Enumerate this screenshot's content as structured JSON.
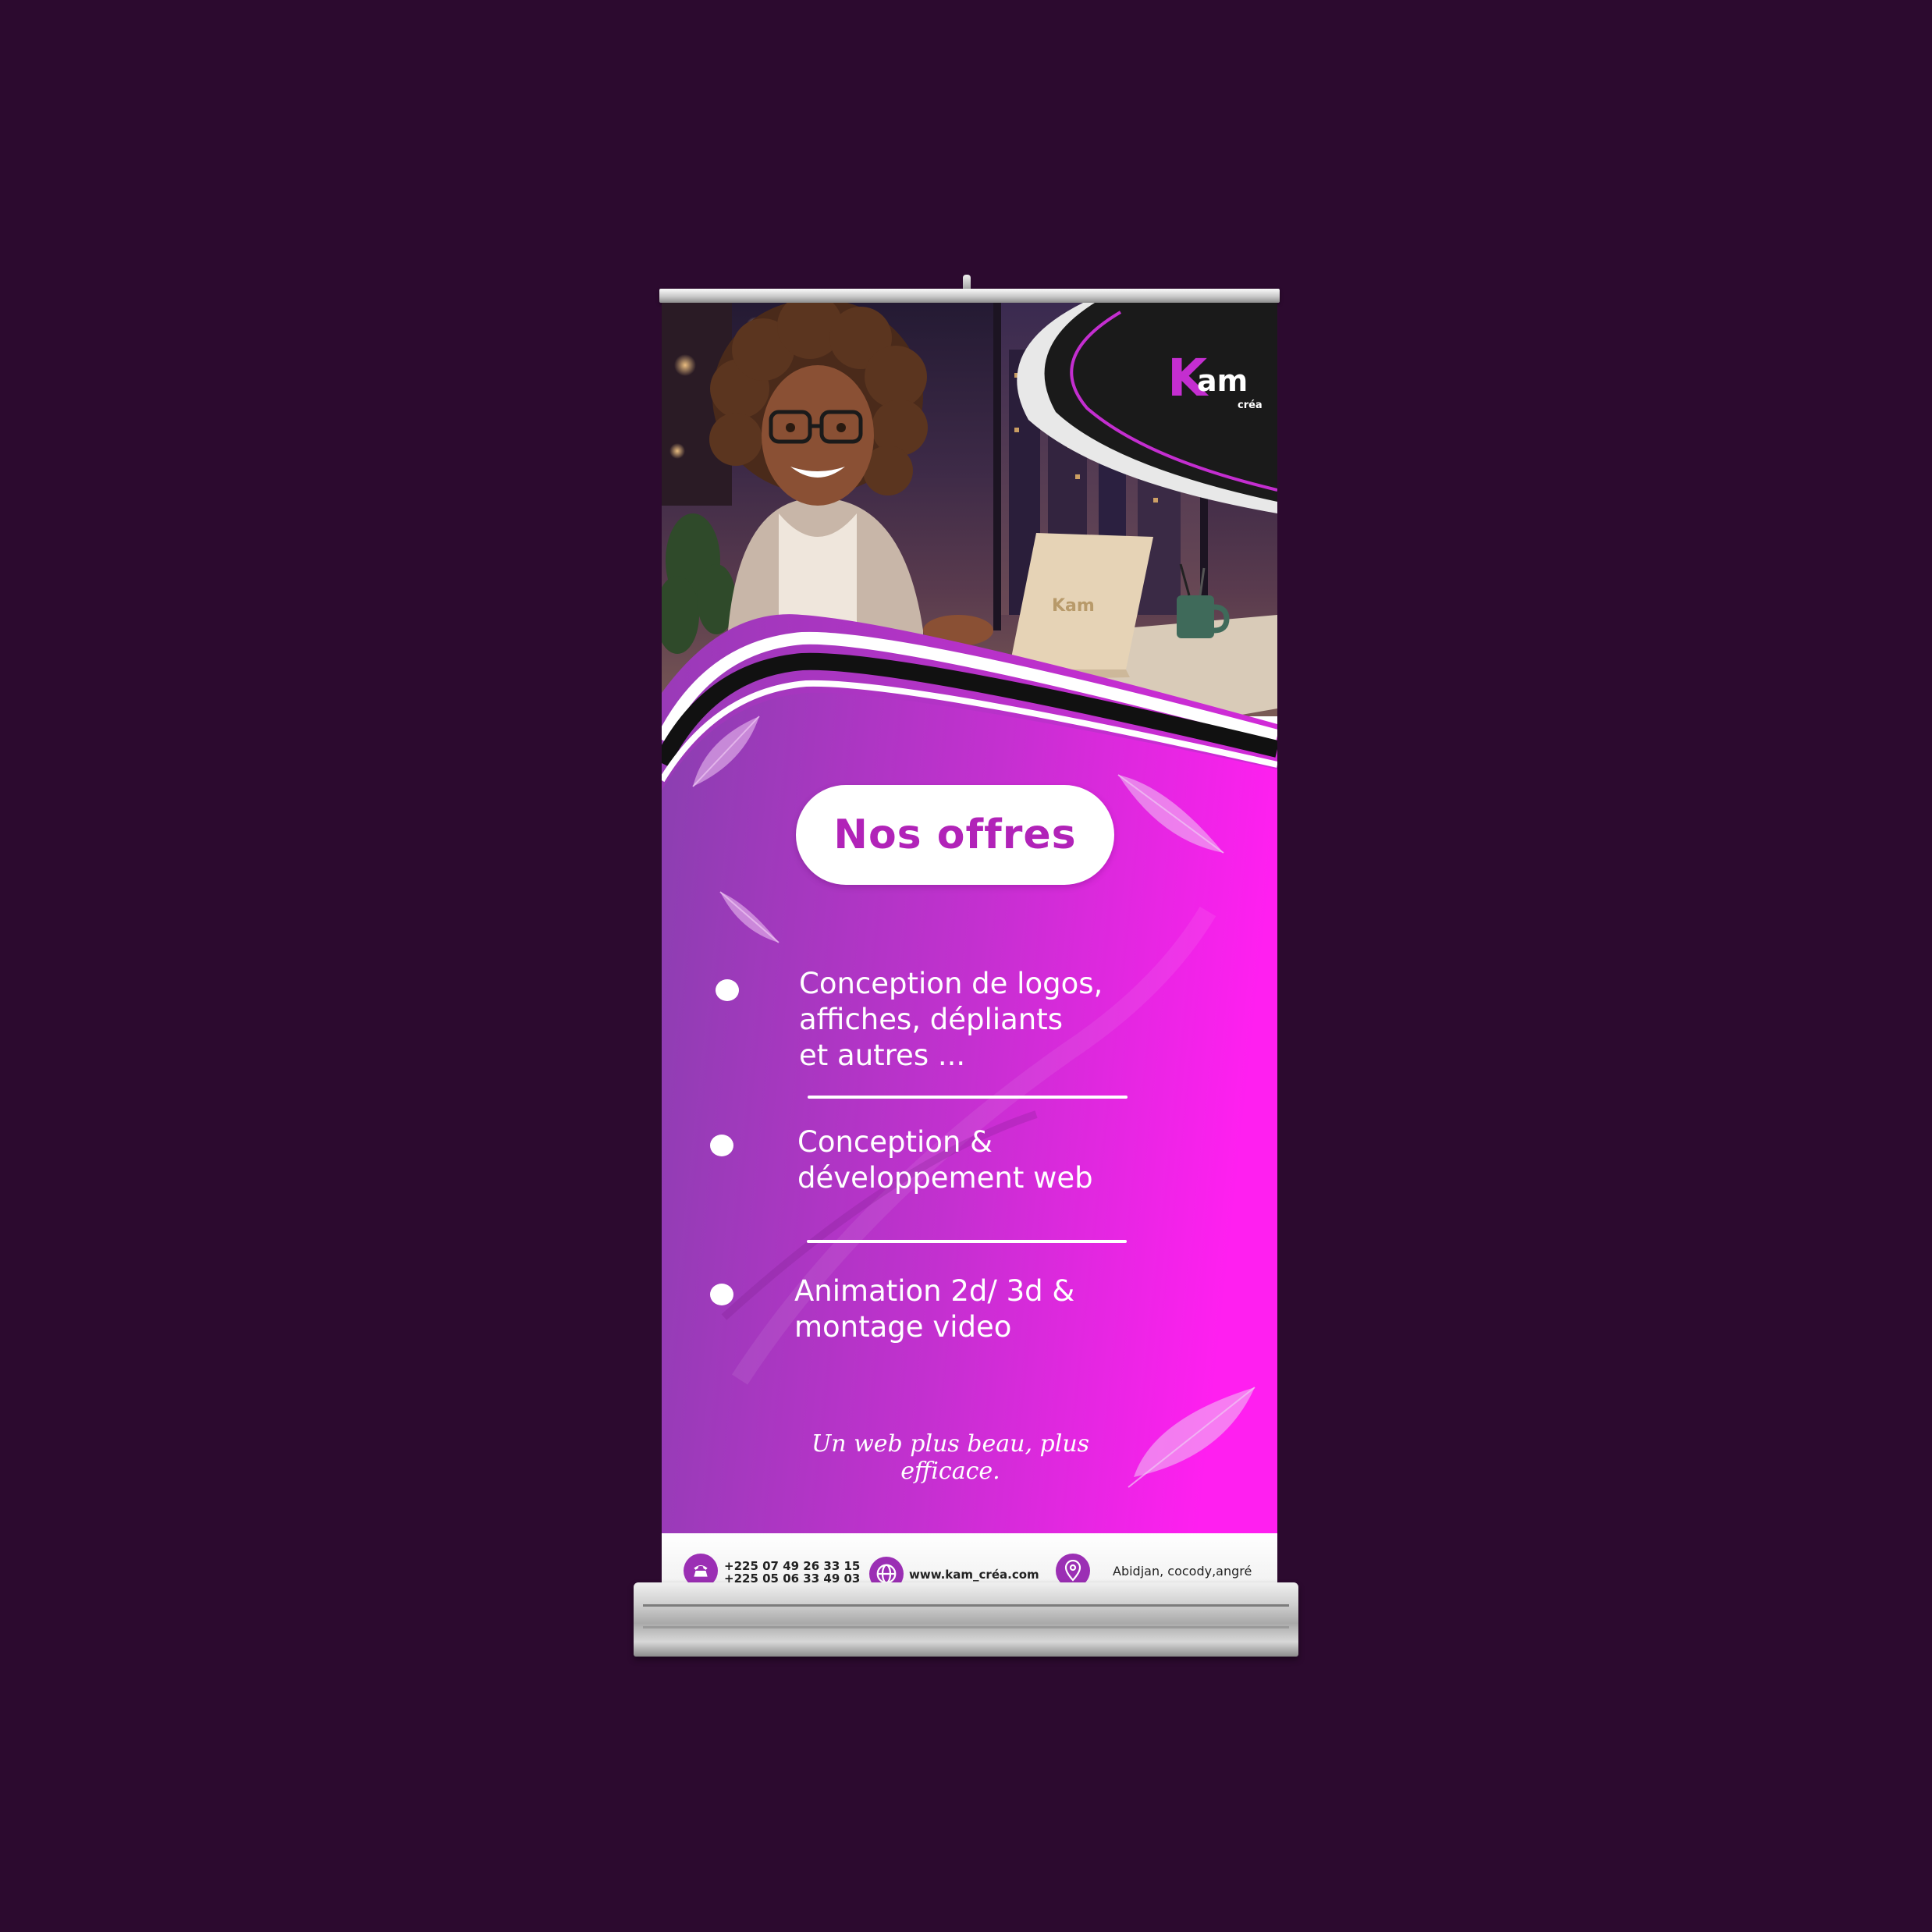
{
  "brand": {
    "logo_k": "K",
    "logo_am": "am",
    "logo_sub": "créa",
    "laptop_mark": "Kam",
    "colors": {
      "primary": "#c42ed0",
      "gradient_start": "#8a3fb0",
      "gradient_end": "#ff1ff0",
      "background": "#2c0a2f"
    }
  },
  "offers": {
    "title": "Nos offres",
    "items": [
      {
        "text": "Conception de logos,\naffiches, dépliants\net autres ..."
      },
      {
        "text": "Conception &\ndéveloppement web"
      },
      {
        "text": "Animation 2d/ 3d &\n montage video"
      }
    ]
  },
  "slogan": "Un web plus beau, plus efficace.",
  "footer": {
    "phone_icon": "phone-icon",
    "phone_1": "+225 07 49 26 33 15",
    "phone_2": "+225 05 06 33 49 03",
    "web_icon": "globe-icon",
    "website": "www.kam_créa.com",
    "location_icon": "location-pin-icon",
    "address": "Abidjan, cocody,angré"
  }
}
